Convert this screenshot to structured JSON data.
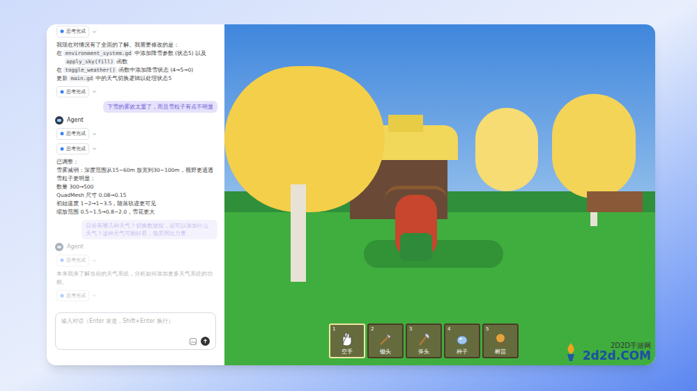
{
  "chat": {
    "messages": [
      {
        "kind": "chip",
        "text": "思考完成",
        "dim": false
      },
      {
        "kind": "text",
        "dim": false,
        "lines": [
          [
            {
              "kind": "text",
              "text": "我现在对情况有了全面的了解。我需要修改的是："
            }
          ],
          [
            {
              "kind": "text",
              "text": "在 "
            },
            {
              "kind": "code",
              "text": "environment_system.gd"
            },
            {
              "kind": "text",
              "text": " 中添加降雪参数 (状态5) 以及"
            }
          ],
          [
            {
              "kind": "code",
              "text": "apply_sky(fill)"
            },
            {
              "kind": "text",
              "text": " 函数"
            }
          ],
          [
            {
              "kind": "text",
              "text": "在 "
            },
            {
              "kind": "code",
              "text": "toggle_weather()"
            },
            {
              "kind": "text",
              "text": " 函数中添加降雪状态 (4→5→0)"
            }
          ],
          [
            {
              "kind": "text",
              "text": "更新 "
            },
            {
              "kind": "code",
              "text": "main.gd"
            },
            {
              "kind": "text",
              "text": " 中的天气切换逻辑以处理状态5"
            }
          ]
        ]
      },
      {
        "kind": "chip",
        "text": "思考完成",
        "dim": false
      },
      {
        "kind": "user",
        "text": "下雪的雾效太重了，而且雪粒子有点不明显",
        "dim": false
      },
      {
        "kind": "agent",
        "text": "Agent",
        "dim": false
      },
      {
        "kind": "chip",
        "text": "思考完成",
        "dim": false
      },
      {
        "kind": "chip",
        "text": "思考完成",
        "dim": false
      },
      {
        "kind": "text",
        "dim": false,
        "lines": [
          [
            {
              "kind": "text",
              "text": "已调整："
            }
          ],
          [
            {
              "kind": "text",
              "text": "雪雾减弱：深度范围从15~60m 放宽到30~100m，视野更通透"
            }
          ],
          [
            {
              "kind": "text",
              "text": "雪粒子更明显："
            }
          ],
          [
            {
              "kind": "text",
              "text": "数量 300→500"
            }
          ],
          [
            {
              "kind": "text",
              "text": "QuadMesh 尺寸 0.08→0.15"
            }
          ],
          [
            {
              "kind": "text",
              "text": "初始速度 1~2→1~3.5，随落轨迹更可见"
            }
          ],
          [
            {
              "kind": "text",
              "text": "缩放范围 0.5~1.5→0.8~2.0，雪花更大"
            }
          ]
        ]
      },
      {
        "kind": "user",
        "text": "目前有哪几种天气？切换数据按，还可以添加什么天气？这种天气可能好看，场景同比力要",
        "dim": true
      },
      {
        "kind": "agent",
        "text": "Agent",
        "dim": true
      },
      {
        "kind": "chip",
        "text": "思考完成",
        "dim": true
      },
      {
        "kind": "text",
        "dim": true,
        "lines": [
          [
            {
              "kind": "text",
              "text": "本来我来了解当前的天气系统，分析如何添加更多天气系统的功能。"
            }
          ]
        ]
      },
      {
        "kind": "chip",
        "text": "思考完成",
        "dim": true
      }
    ]
  },
  "input": {
    "placeholder": "输入对话（Enter 发送，Shift+Enter 换行）"
  },
  "hotbar": [
    {
      "key": "1",
      "label": "空手",
      "kind": "hand",
      "selected": true
    },
    {
      "key": "2",
      "label": "锄头",
      "kind": "hoe",
      "selected": false
    },
    {
      "key": "3",
      "label": "斧头",
      "kind": "axe",
      "selected": false
    },
    {
      "key": "4",
      "label": "种子",
      "kind": "seed",
      "selected": false
    },
    {
      "key": "5",
      "label": "树苗",
      "kind": "sapling",
      "selected": false
    }
  ],
  "watermark": {
    "name": "2D2D手游网",
    "url": "2d2d.COM"
  }
}
